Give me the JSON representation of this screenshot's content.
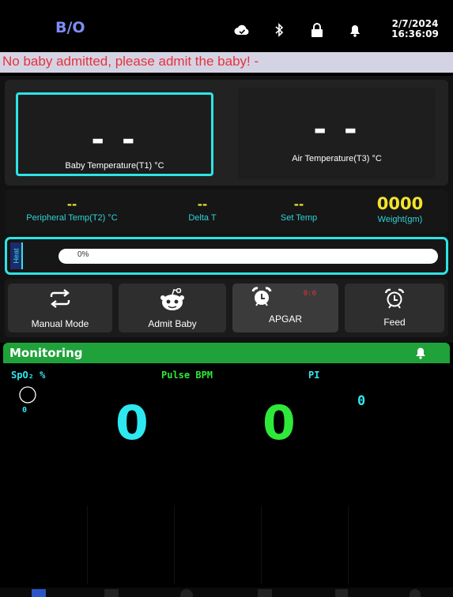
{
  "header": {
    "bed_id": "B/O",
    "date": "2/7/2024",
    "time": "16:36:09",
    "icons": [
      "cloud-icon",
      "bluetooth-icon",
      "lock-icon",
      "bell-icon"
    ]
  },
  "alarm": {
    "message": "No baby admitted, please admit the baby! -",
    "color": "#e7313d"
  },
  "temperature": {
    "baby": {
      "value": "- -",
      "label": "Baby Temperature(T1) °C"
    },
    "air": {
      "value": "- -",
      "label": "Air Temperature(T3) °C"
    }
  },
  "vitals": [
    {
      "value": "--",
      "label": "Peripheral Temp(T2) °C"
    },
    {
      "value": "--",
      "label": "Delta T"
    },
    {
      "value": "--",
      "label": "Set Temp"
    },
    {
      "value": "0000",
      "label": "Weight(gm)"
    }
  ],
  "heat": {
    "tab_label": "Heat",
    "level_text": "0%",
    "level_fraction": 0
  },
  "actions": [
    {
      "label": "Manual Mode",
      "icon": "repeat-icon"
    },
    {
      "label": "Admit Baby",
      "icon": "baby-face-icon"
    },
    {
      "label": "APGAR",
      "icon": "alarm-clock-icon",
      "timer": "0:0"
    },
    {
      "label": "Feed",
      "icon": "alarm-clock-outline-icon"
    }
  ],
  "monitoring": {
    "title": "Monitoring",
    "spo2_label": "SpO₂ %",
    "spo2_value": "0",
    "spo2_small": "0",
    "pulse_label": "Pulse BPM",
    "pulse_value": "0",
    "pi_label": "PI",
    "pi_value": "0"
  },
  "colors": {
    "accent_cyan": "#2ee3e6",
    "header_green": "#1fa23a",
    "spo2_cyan": "#2ee8f0",
    "pulse_green": "#2ee83a",
    "vital_yellow": "#f2e52a"
  }
}
